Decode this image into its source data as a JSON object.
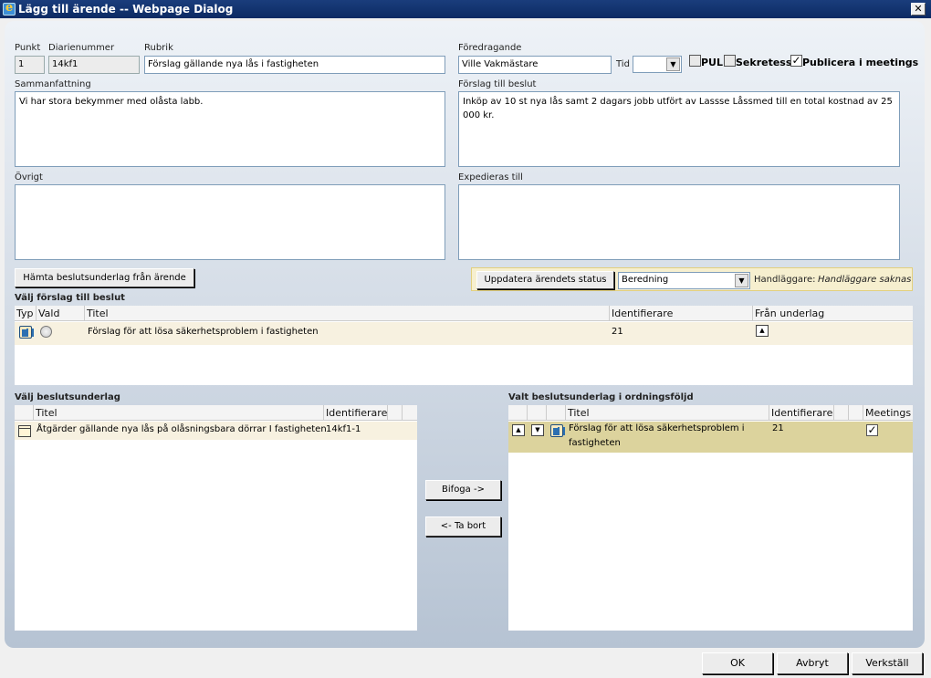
{
  "window": {
    "title": "Lägg till ärende -- Webpage Dialog",
    "close_label": "✕"
  },
  "form": {
    "punkt_label": "Punkt",
    "punkt_value": "1",
    "diarienummer_label": "Diarienummer",
    "diarienummer_value": "14kf1",
    "rubrik_label": "Rubrik",
    "rubrik_value": "Förslag gällande nya lås i fastigheten",
    "foredragande_label": "Föredragande",
    "foredragande_value": "Ville Vakmästare",
    "tid_label": "Tid",
    "tid_value": "",
    "pul_label": "PUL",
    "pul_checked": false,
    "sekretess_label": "Sekretess",
    "sekretess_checked": false,
    "publicera_label": "Publicera i meetings",
    "publicera_checked": true,
    "sammanfattning_label": "Sammanfattning",
    "sammanfattning_value": "Vi har stora bekymmer med olåsta labb.",
    "forslag_label": "Förslag till beslut",
    "forslag_value": "Inköp av 10 st nya lås samt 2 dagars jobb utfört av Lassse Låssmed till en total kostnad av 25 000 kr.",
    "ovrigt_label": "Övrigt",
    "ovrigt_value": "",
    "expedieras_label": "Expedieras till",
    "expedieras_value": ""
  },
  "actions": {
    "hamta_label": "Hämta beslutsunderlag från ärende",
    "uppdatera_label": "Uppdatera ärendets status",
    "status_value": "Beredning",
    "handlaggare_label": "Handläggare:",
    "handlaggare_value": "Handläggare saknas"
  },
  "proposals": {
    "section_label": "Välj förslag till beslut",
    "headers": [
      "Typ",
      "Vald",
      "Titel",
      "Identifierare",
      "Från underlag"
    ],
    "rows": [
      {
        "title": "Förslag för att lösa säkerhetsproblem i fastigheten",
        "id": "21",
        "selected": false
      }
    ]
  },
  "underlag": {
    "section_label": "Välj beslutsunderlag",
    "headers": [
      "Titel",
      "Identifierare"
    ],
    "rows": [
      {
        "title": "Åtgärder gällande nya lås på olåsningsbara dörrar I fastigheten",
        "id": "14kf1-1"
      }
    ]
  },
  "transfer": {
    "attach_label": "Bifoga ->",
    "remove_label": "<- Ta bort"
  },
  "selected_underlag": {
    "section_label": "Valt beslutsunderlag i ordningsföljd",
    "headers": [
      "Titel",
      "Identifierare",
      "Meetings"
    ],
    "rows": [
      {
        "title_line1": "Förslag för att lösa säkerhetsproblem i",
        "title_line2": "fastigheten",
        "id": "21",
        "meetings": true
      }
    ]
  },
  "footer": {
    "ok_label": "OK",
    "cancel_label": "Avbryt",
    "apply_label": "Verkställ"
  }
}
